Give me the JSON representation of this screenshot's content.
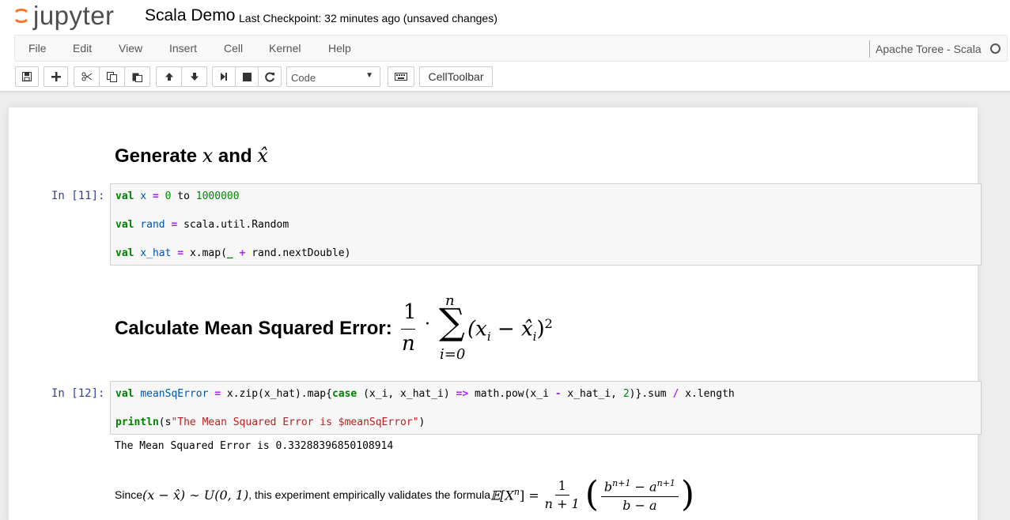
{
  "header": {
    "logo_text": "jupyter",
    "notebook_name": "Scala Demo",
    "checkpoint": "Last Checkpoint: 32 minutes ago (unsaved changes)"
  },
  "menu": [
    "File",
    "Edit",
    "View",
    "Insert",
    "Cell",
    "Kernel",
    "Help"
  ],
  "kernel": {
    "name": "Apache Toree - Scala"
  },
  "toolbar": {
    "cell_type": "Code",
    "celltoolbar_label": "CellToolbar",
    "icons": [
      "save-icon",
      "plus-icon",
      "cut-icon",
      "copy-icon",
      "paste-icon",
      "arrow-up-icon",
      "arrow-down-icon",
      "step-forward-icon",
      "stop-icon",
      "refresh-icon",
      "keyboard-icon"
    ]
  },
  "cells": {
    "md1": {
      "text": "Generate ",
      "x": "x",
      "and": " and ",
      "xhat": "x̂"
    },
    "code1": {
      "prompt": "In [11]:",
      "line1": {
        "kw": "val",
        "var": "x",
        "eq": "=",
        "n0": "0",
        "to": "to",
        "n1": "1000000"
      },
      "line2": {
        "kw": "val",
        "var": "rand",
        "eq": "=",
        "rest": "scala.util.Random"
      },
      "line3": {
        "kw": "val",
        "var": "x_hat",
        "eq": "=",
        "pre": "x.map(",
        "us": "_",
        "plus": "+",
        "rest": "rand.nextDouble)"
      }
    },
    "md2": {
      "text": "Calculate Mean Squared Error:",
      "one": "1",
      "n": "n",
      "dot": "·",
      "sum": "∑",
      "sum_top": "n",
      "sum_bottom": "i=0",
      "body": "(x",
      "sub_i": "i",
      "minus": " − ",
      "xhat": "x̂",
      "sub_i2": "i",
      "close": ")",
      "pow": "2"
    },
    "code2": {
      "prompt": "In [12]:",
      "line1": {
        "kw": "val",
        "var": "meanSqError",
        "eq": "=",
        "a": "x.zip(x_hat).map{",
        "case": "case",
        "b": "(x_i, x_hat_i)",
        "arrow": "=>",
        "c": "math.pow(x_i",
        "minus": "-",
        "d": "x_hat_i,",
        "two": "2",
        "e": ")}.sum",
        "slash": "/",
        "f": "x.length"
      },
      "line2": {
        "fn": "println",
        "open": "(s",
        "str": "\"The Mean Squared Error is $meanSqError\"",
        "close": ")"
      }
    },
    "output": "The Mean Squared Error is 0.33288396850108914",
    "md3": {
      "since": "Since ",
      "expr": "(x − x̂) ∼ U(0, 1)",
      "text": ", this experiment empirically validates the formula ",
      "lhs": "𝔼[X",
      "lhs_pow": "n",
      "lhs_close": "] = ",
      "f1_top": "1",
      "f1_bot": "n + 1",
      "f2_top": "b",
      "f2_top_pow": "n+1",
      "f2_top_mid": " − a",
      "f2_top_pow2": "n+1",
      "f2_bot": "b − a"
    }
  }
}
